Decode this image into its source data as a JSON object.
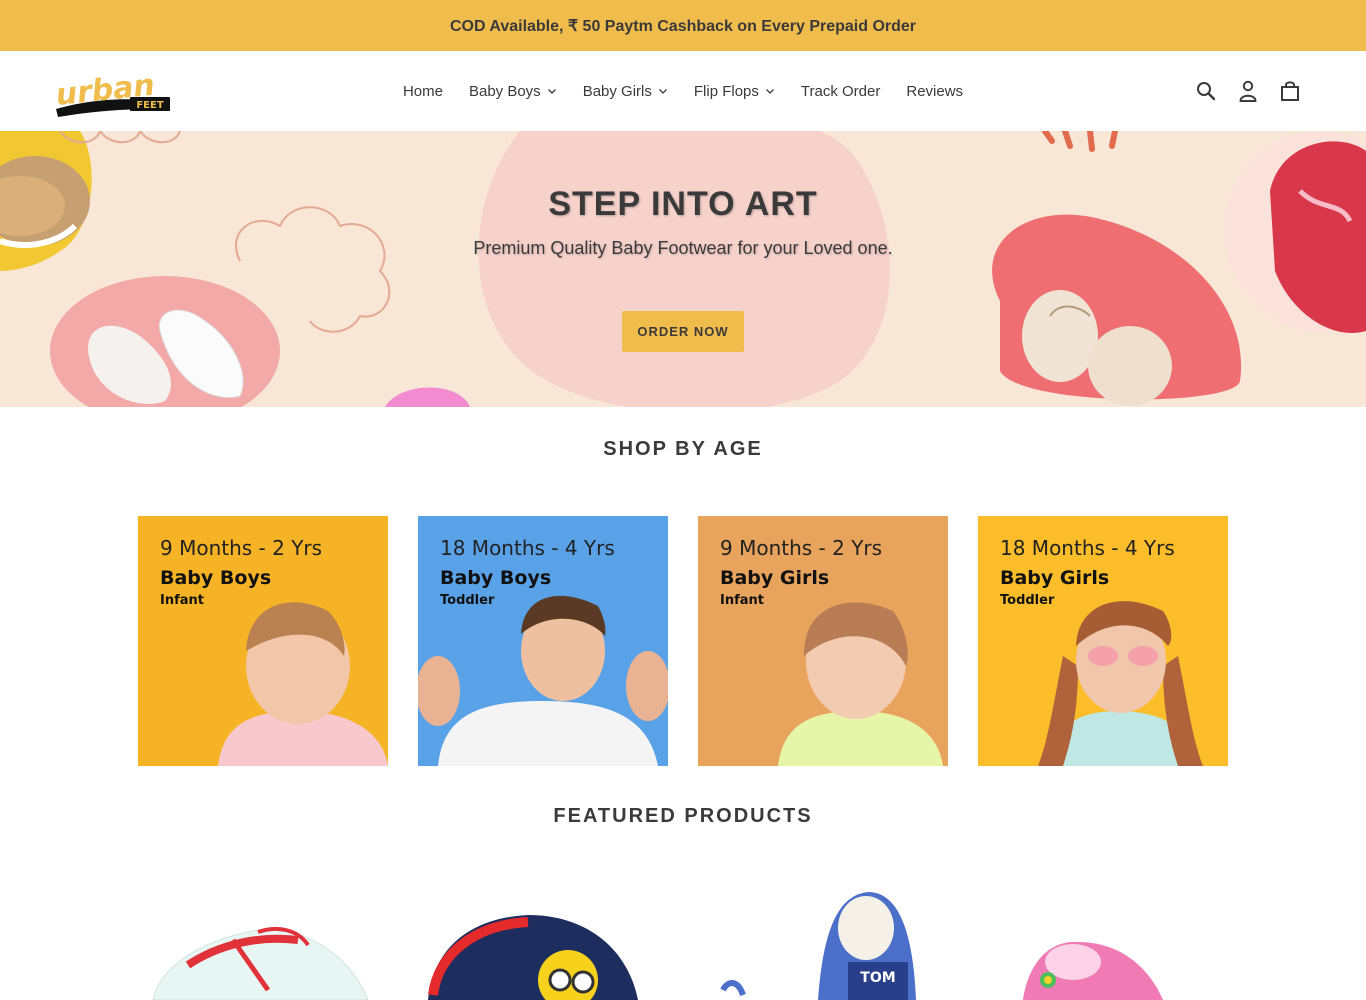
{
  "announcement": {
    "text": "COD Available, ₹ 50 Paytm Cashback on Every Prepaid Order"
  },
  "header": {
    "logo_text": "Urban",
    "logo_badge": "FEET",
    "nav": [
      {
        "label": "Home",
        "dropdown": false
      },
      {
        "label": "Baby Boys",
        "dropdown": true
      },
      {
        "label": "Baby Girls",
        "dropdown": true
      },
      {
        "label": "Flip Flops",
        "dropdown": true
      },
      {
        "label": "Track Order",
        "dropdown": false
      },
      {
        "label": "Reviews",
        "dropdown": false
      }
    ],
    "icons": [
      "search-icon",
      "account-icon",
      "cart-icon"
    ]
  },
  "hero": {
    "title": "STEP INTO ART",
    "subtitle": "Premium Quality Baby Footwear for your Loved one.",
    "button": "ORDER NOW"
  },
  "shop_by_age": {
    "title": "SHOP BY AGE",
    "cards": [
      {
        "range": "9 Months - 2 Yrs",
        "category": "Baby Boys",
        "stage": "Infant",
        "bg": "#f6b325"
      },
      {
        "range": "18 Months - 4 Yrs",
        "category": "Baby Boys",
        "stage": "Toddler",
        "bg": "#5aa2e8"
      },
      {
        "range": "9 Months - 2 Yrs",
        "category": "Baby Girls",
        "stage": "Infant",
        "bg": "#e8a35c"
      },
      {
        "range": "18 Months - 4 Yrs",
        "category": "Baby Girls",
        "stage": "Toddler",
        "bg": "#fbbd2a"
      }
    ]
  },
  "featured": {
    "title": "FEATURED PRODUCTS"
  },
  "colors": {
    "accent": "#f0bd4c",
    "text": "#3a3a3a",
    "hero_bg": "#f8e7d6"
  }
}
